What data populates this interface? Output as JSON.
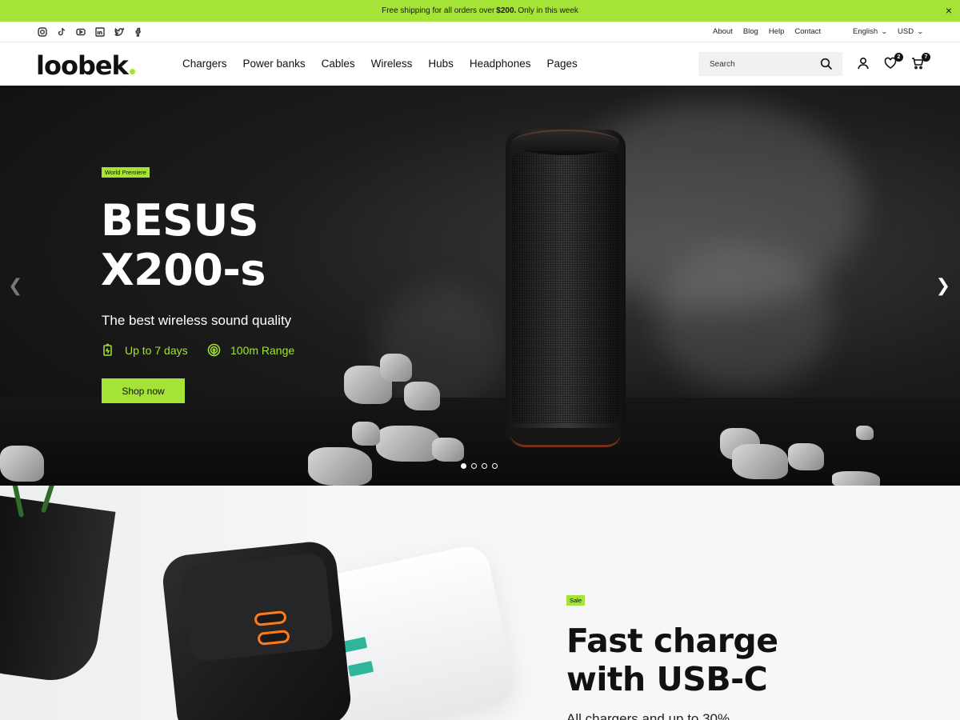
{
  "announcement": {
    "text_before": "Free shipping for all orders over",
    "amount": "$200.",
    "text_after": "Only in this week",
    "close_label": "×"
  },
  "utility": {
    "socials": [
      "instagram-icon",
      "tiktok-icon",
      "youtube-icon",
      "linkedin-icon",
      "twitter-icon",
      "facebook-icon"
    ],
    "links": [
      "About",
      "Blog",
      "Help",
      "Contact"
    ],
    "language": "English",
    "currency": "USD"
  },
  "header": {
    "logo": "loobek",
    "nav": [
      "Chargers",
      "Power banks",
      "Cables",
      "Wireless",
      "Hubs",
      "Headphones",
      "Pages"
    ],
    "search_placeholder": "Search",
    "wishlist_count": "2",
    "cart_count": "7"
  },
  "hero": {
    "tag": "World Premiere",
    "title_line1": "BESUS",
    "title_line2": "X200-s",
    "subtitle": "The best wireless sound quality",
    "feature1": "Up to 7 days",
    "feature2": "100m Range",
    "cta": "Shop now",
    "slides_total": 4,
    "active_slide": 1,
    "prev_arrow": "❮",
    "next_arrow": "❯"
  },
  "promo": {
    "tag": "Sale",
    "title_line1": "Fast charge",
    "title_line2": "with USB-C",
    "description": "All chargers and up to 30%"
  },
  "colors": {
    "accent": "#a5e336",
    "dark": "#111111",
    "port_accent": "#ff7a1a"
  }
}
